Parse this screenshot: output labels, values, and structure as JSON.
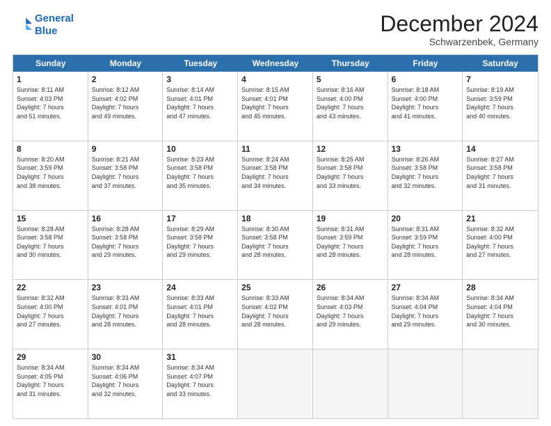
{
  "logo": {
    "line1": "General",
    "line2": "Blue"
  },
  "title": "December 2024",
  "location": "Schwarzenbek, Germany",
  "days": [
    "Sunday",
    "Monday",
    "Tuesday",
    "Wednesday",
    "Thursday",
    "Friday",
    "Saturday"
  ],
  "weeks": [
    [
      {
        "day": "1",
        "rise": "8:11 AM",
        "set": "4:03 PM",
        "daylight": "7 hours and 51 minutes."
      },
      {
        "day": "2",
        "rise": "8:12 AM",
        "set": "4:02 PM",
        "daylight": "7 hours and 49 minutes."
      },
      {
        "day": "3",
        "rise": "8:14 AM",
        "set": "4:01 PM",
        "daylight": "7 hours and 47 minutes."
      },
      {
        "day": "4",
        "rise": "8:15 AM",
        "set": "4:01 PM",
        "daylight": "7 hours and 45 minutes."
      },
      {
        "day": "5",
        "rise": "8:16 AM",
        "set": "4:00 PM",
        "daylight": "7 hours and 43 minutes."
      },
      {
        "day": "6",
        "rise": "8:18 AM",
        "set": "4:00 PM",
        "daylight": "7 hours and 41 minutes."
      },
      {
        "day": "7",
        "rise": "8:19 AM",
        "set": "3:59 PM",
        "daylight": "7 hours and 40 minutes."
      }
    ],
    [
      {
        "day": "8",
        "rise": "8:20 AM",
        "set": "3:59 PM",
        "daylight": "7 hours and 38 minutes."
      },
      {
        "day": "9",
        "rise": "8:21 AM",
        "set": "3:58 PM",
        "daylight": "7 hours and 37 minutes."
      },
      {
        "day": "10",
        "rise": "8:23 AM",
        "set": "3:58 PM",
        "daylight": "7 hours and 35 minutes."
      },
      {
        "day": "11",
        "rise": "8:24 AM",
        "set": "3:58 PM",
        "daylight": "7 hours and 34 minutes."
      },
      {
        "day": "12",
        "rise": "8:25 AM",
        "set": "3:58 PM",
        "daylight": "7 hours and 33 minutes."
      },
      {
        "day": "13",
        "rise": "8:26 AM",
        "set": "3:58 PM",
        "daylight": "7 hours and 32 minutes."
      },
      {
        "day": "14",
        "rise": "8:27 AM",
        "set": "3:58 PM",
        "daylight": "7 hours and 31 minutes."
      }
    ],
    [
      {
        "day": "15",
        "rise": "8:28 AM",
        "set": "3:58 PM",
        "daylight": "7 hours and 30 minutes."
      },
      {
        "day": "16",
        "rise": "8:28 AM",
        "set": "3:58 PM",
        "daylight": "7 hours and 29 minutes."
      },
      {
        "day": "17",
        "rise": "8:29 AM",
        "set": "3:58 PM",
        "daylight": "7 hours and 29 minutes."
      },
      {
        "day": "18",
        "rise": "8:30 AM",
        "set": "3:58 PM",
        "daylight": "7 hours and 28 minutes."
      },
      {
        "day": "19",
        "rise": "8:31 AM",
        "set": "3:59 PM",
        "daylight": "7 hours and 28 minutes."
      },
      {
        "day": "20",
        "rise": "8:31 AM",
        "set": "3:59 PM",
        "daylight": "7 hours and 28 minutes."
      },
      {
        "day": "21",
        "rise": "8:32 AM",
        "set": "4:00 PM",
        "daylight": "7 hours and 27 minutes."
      }
    ],
    [
      {
        "day": "22",
        "rise": "8:32 AM",
        "set": "4:00 PM",
        "daylight": "7 hours and 27 minutes."
      },
      {
        "day": "23",
        "rise": "8:33 AM",
        "set": "4:01 PM",
        "daylight": "7 hours and 28 minutes."
      },
      {
        "day": "24",
        "rise": "8:33 AM",
        "set": "4:01 PM",
        "daylight": "7 hours and 28 minutes."
      },
      {
        "day": "25",
        "rise": "8:33 AM",
        "set": "4:02 PM",
        "daylight": "7 hours and 28 minutes."
      },
      {
        "day": "26",
        "rise": "8:34 AM",
        "set": "4:03 PM",
        "daylight": "7 hours and 29 minutes."
      },
      {
        "day": "27",
        "rise": "8:34 AM",
        "set": "4:04 PM",
        "daylight": "7 hours and 29 minutes."
      },
      {
        "day": "28",
        "rise": "8:34 AM",
        "set": "4:04 PM",
        "daylight": "7 hours and 30 minutes."
      }
    ],
    [
      {
        "day": "29",
        "rise": "8:34 AM",
        "set": "4:05 PM",
        "daylight": "7 hours and 31 minutes."
      },
      {
        "day": "30",
        "rise": "8:34 AM",
        "set": "4:06 PM",
        "daylight": "7 hours and 32 minutes."
      },
      {
        "day": "31",
        "rise": "8:34 AM",
        "set": "4:07 PM",
        "daylight": "7 hours and 33 minutes."
      },
      null,
      null,
      null,
      null
    ]
  ]
}
